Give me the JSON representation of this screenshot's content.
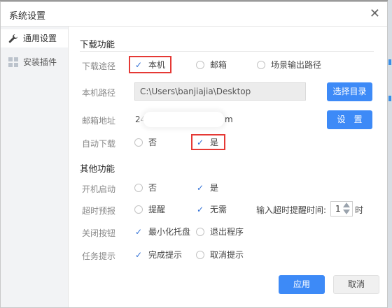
{
  "dialog": {
    "title": "系统设置",
    "close_glyph": "✕"
  },
  "sidebar": {
    "items": [
      {
        "label": "通用设置",
        "icon": "wrench-icon",
        "active": true
      },
      {
        "label": "安装插件",
        "icon": "grid-icon",
        "active": false
      }
    ]
  },
  "download": {
    "section_title": "下载功能",
    "route": {
      "label": "下载途径",
      "options": [
        "本机",
        "邮箱",
        "场景输出路径"
      ],
      "selected": "本机"
    },
    "local_path": {
      "label": "本机路径",
      "value": "C:\\Users\\banjiajia\\Desktop",
      "button": "选择目录"
    },
    "email": {
      "label": "邮箱地址",
      "value_prefix": "24.",
      "value_suffix": "m",
      "button": "设　置"
    },
    "auto_download": {
      "label": "自动下载",
      "options": [
        "否",
        "是"
      ],
      "selected": "是"
    }
  },
  "other": {
    "section_title": "其他功能",
    "startup": {
      "label": "开机启动",
      "options": [
        "否",
        "是"
      ],
      "selected": "是"
    },
    "timeout": {
      "label": "超时预报",
      "options": [
        "提醒",
        "无需"
      ],
      "selected": "无需",
      "input_label": "输入超时提醒时间:",
      "value": "1",
      "unit": "时"
    },
    "close_button": {
      "label": "关闭按钮",
      "options": [
        "最小化托盘",
        "退出程序"
      ],
      "selected": "最小化托盘"
    },
    "task_hint": {
      "label": "任务提示",
      "options": [
        "完成提示",
        "取消提示"
      ],
      "selected": "完成提示"
    }
  },
  "footer": {
    "apply": "应用",
    "cancel": "取消"
  },
  "colors": {
    "accent": "#3d8af7",
    "highlight": "#e53935",
    "check": "#2f6fd6"
  }
}
